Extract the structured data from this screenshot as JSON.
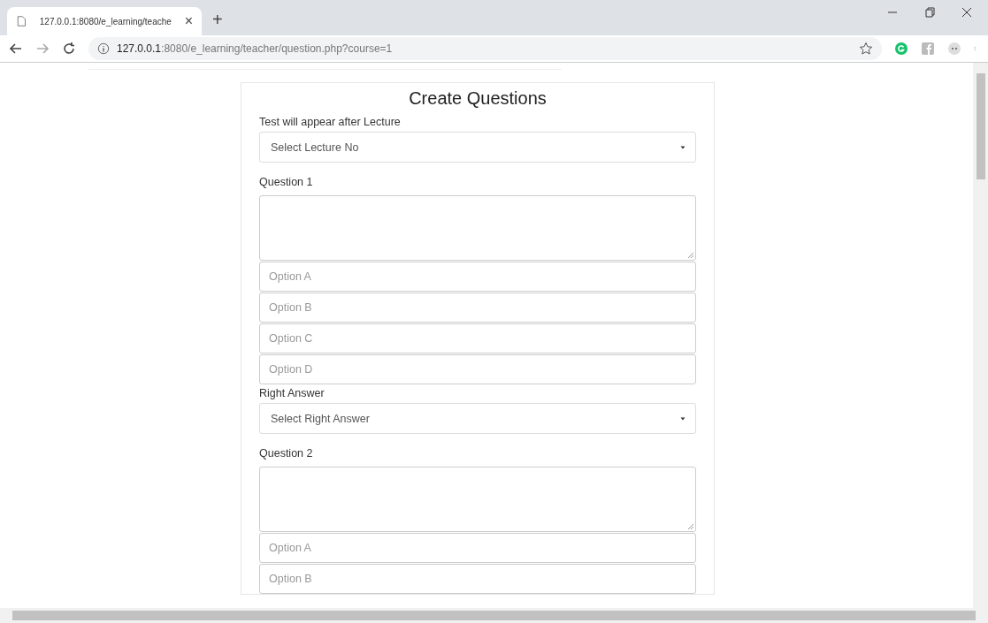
{
  "browser": {
    "tab_title": "127.0.0.1:8080/e_learning/teache",
    "tab_close": "×",
    "new_tab": "+",
    "url_host": "127.0.0.1",
    "url_rest": ":8080/e_learning/teacher/question.php?course=1"
  },
  "form": {
    "title": "Create Questions",
    "lecture_label": "Test will appear after Lecture",
    "lecture_select": "Select Lecture No",
    "questions": [
      {
        "label": "Question 1",
        "options": [
          "Option A",
          "Option B",
          "Option C",
          "Option D"
        ],
        "answer_label": "Right Answer",
        "answer_select": "Select Right Answer"
      },
      {
        "label": "Question 2",
        "options": [
          "Option A",
          "Option B"
        ]
      }
    ]
  }
}
